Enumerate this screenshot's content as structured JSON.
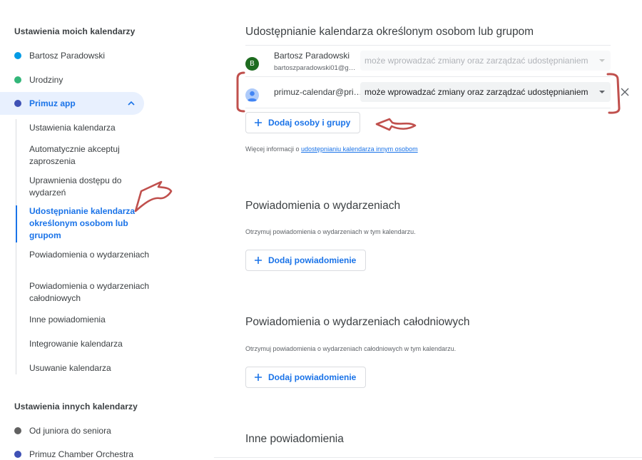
{
  "sidebar": {
    "my_calendars_title": "Ustawienia moich kalendarzy",
    "my_calendars": [
      {
        "label": "Bartosz Paradowski",
        "color": "#039be5"
      },
      {
        "label": "Urodziny",
        "color": "#33b679"
      },
      {
        "label": "Primuz app",
        "color": "#3f51b5",
        "expanded": true
      }
    ],
    "sub_items": [
      {
        "label": "Ustawienia kalendarza"
      },
      {
        "label": "Automatycznie akceptuj zaproszenia"
      },
      {
        "label": "Uprawnienia dostępu do wydarzeń"
      },
      {
        "label": "Udostępnianie kalendarza określonym osobom lub grupom",
        "current": true
      },
      {
        "label": "Powiadomienia o wydarzeniach"
      },
      {
        "label": "Powiadomienia o wydarzeniach całodniowych"
      },
      {
        "label": "Inne powiadomienia"
      },
      {
        "label": "Integrowanie kalendarza"
      },
      {
        "label": "Usuwanie kalendarza"
      }
    ],
    "other_calendars_title": "Ustawienia innych kalendarzy",
    "other_calendars": [
      {
        "label": "Od juniora do seniora",
        "color": "#616161"
      },
      {
        "label": "Primuz Chamber Orchestra",
        "color": "#3f51b5"
      }
    ]
  },
  "main": {
    "sharing": {
      "title": "Udostępnianie kalendarza określonym osobom lub grupom",
      "people": [
        {
          "initial": "B",
          "name": "Bartosz Paradowski",
          "email": "bartoszparadowski01@g…",
          "permission": "może wprowadzać zmiany oraz zarządzać udostępnianiem",
          "editable": false
        },
        {
          "name": "primuz-calendar@pri…",
          "permission": "może wprowadzać zmiany oraz zarządzać udostępnianiem",
          "editable": true
        }
      ],
      "add_button": "Dodaj osoby i grupy",
      "info_prefix": "Więcej informacji o ",
      "info_link": "udostępnianiu kalendarza innym osobom"
    },
    "event_notifications": {
      "title": "Powiadomienia o wydarzeniach",
      "hint": "Otrzymuj powiadomienia o wydarzeniach w tym kalendarzu.",
      "add_button": "Dodaj powiadomienie"
    },
    "allday_notifications": {
      "title": "Powiadomienia o wydarzeniach całodniowych",
      "hint": "Otrzymuj powiadomienia o wydarzeniach całodniowych w tym kalendarzu.",
      "add_button": "Dodaj powiadomienie"
    },
    "other_notifications": {
      "title": "Inne powiadomienia"
    }
  },
  "colors": {
    "accent": "#1a73e8",
    "annotation": "#c0504d"
  }
}
